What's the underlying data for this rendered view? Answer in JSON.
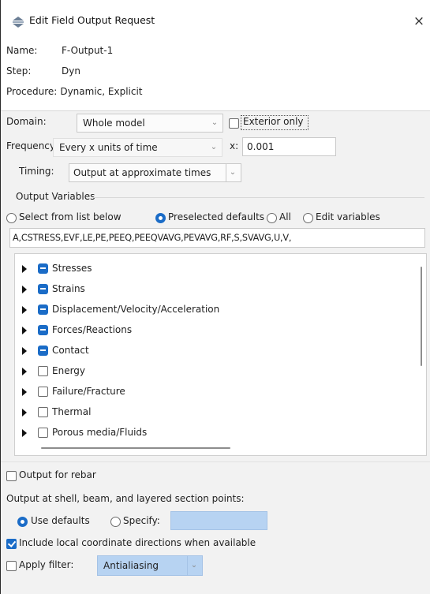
{
  "window": {
    "title": "Edit Field Output Request",
    "close_glyph": "×"
  },
  "info": {
    "name_label": "Name:",
    "name_value": "F-Output-1",
    "step_label": "Step:",
    "step_value": "Dyn",
    "procedure_label": "Procedure:",
    "procedure_value": "Dynamic, Explicit"
  },
  "domain": {
    "label": "Domain:",
    "value": "Whole model",
    "exterior_label": "Exterior only",
    "exterior_checked": false
  },
  "frequency": {
    "label": "Frequency:",
    "value": "Every x units of time",
    "x_label": "x:",
    "x_value": "0.001"
  },
  "timing": {
    "label": "Timing:",
    "value": "Output at approximate times"
  },
  "output_variables": {
    "group_label": "Output Variables",
    "options": [
      {
        "label": "Select from list below",
        "selected": false
      },
      {
        "label": "Preselected defaults",
        "selected": true
      },
      {
        "label": "All",
        "selected": false
      },
      {
        "label": "Edit variables",
        "selected": false
      }
    ],
    "variables_text": "A,CSTRESS,EVF,LE,PE,PEEQ,PEEQVAVG,PEVAVG,RF,S,SVAVG,U,V,",
    "tree": [
      {
        "label": "Stresses",
        "state": "partial"
      },
      {
        "label": "Strains",
        "state": "partial"
      },
      {
        "label": "Displacement/Velocity/Acceleration",
        "state": "partial"
      },
      {
        "label": "Forces/Reactions",
        "state": "partial"
      },
      {
        "label": "Contact",
        "state": "partial"
      },
      {
        "label": "Energy",
        "state": "unchecked"
      },
      {
        "label": "Failure/Fracture",
        "state": "unchecked"
      },
      {
        "label": "Thermal",
        "state": "unchecked"
      },
      {
        "label": "Porous media/Fluids",
        "state": "unchecked"
      }
    ]
  },
  "rebar": {
    "label": "Output for rebar",
    "checked": false
  },
  "section_points": {
    "label": "Output at shell, beam, and layered section points:",
    "use_defaults_label": "Use defaults",
    "use_defaults_selected": true,
    "specify_label": "Specify:",
    "specify_value": ""
  },
  "local_coords": {
    "label": "Include local coordinate directions when available",
    "checked": true
  },
  "filter": {
    "label": "Apply filter:",
    "value": "Antialiasing",
    "checked": false
  },
  "colors": {
    "accent": "#1b6cc7",
    "specify_field": "#b7d3f2"
  }
}
